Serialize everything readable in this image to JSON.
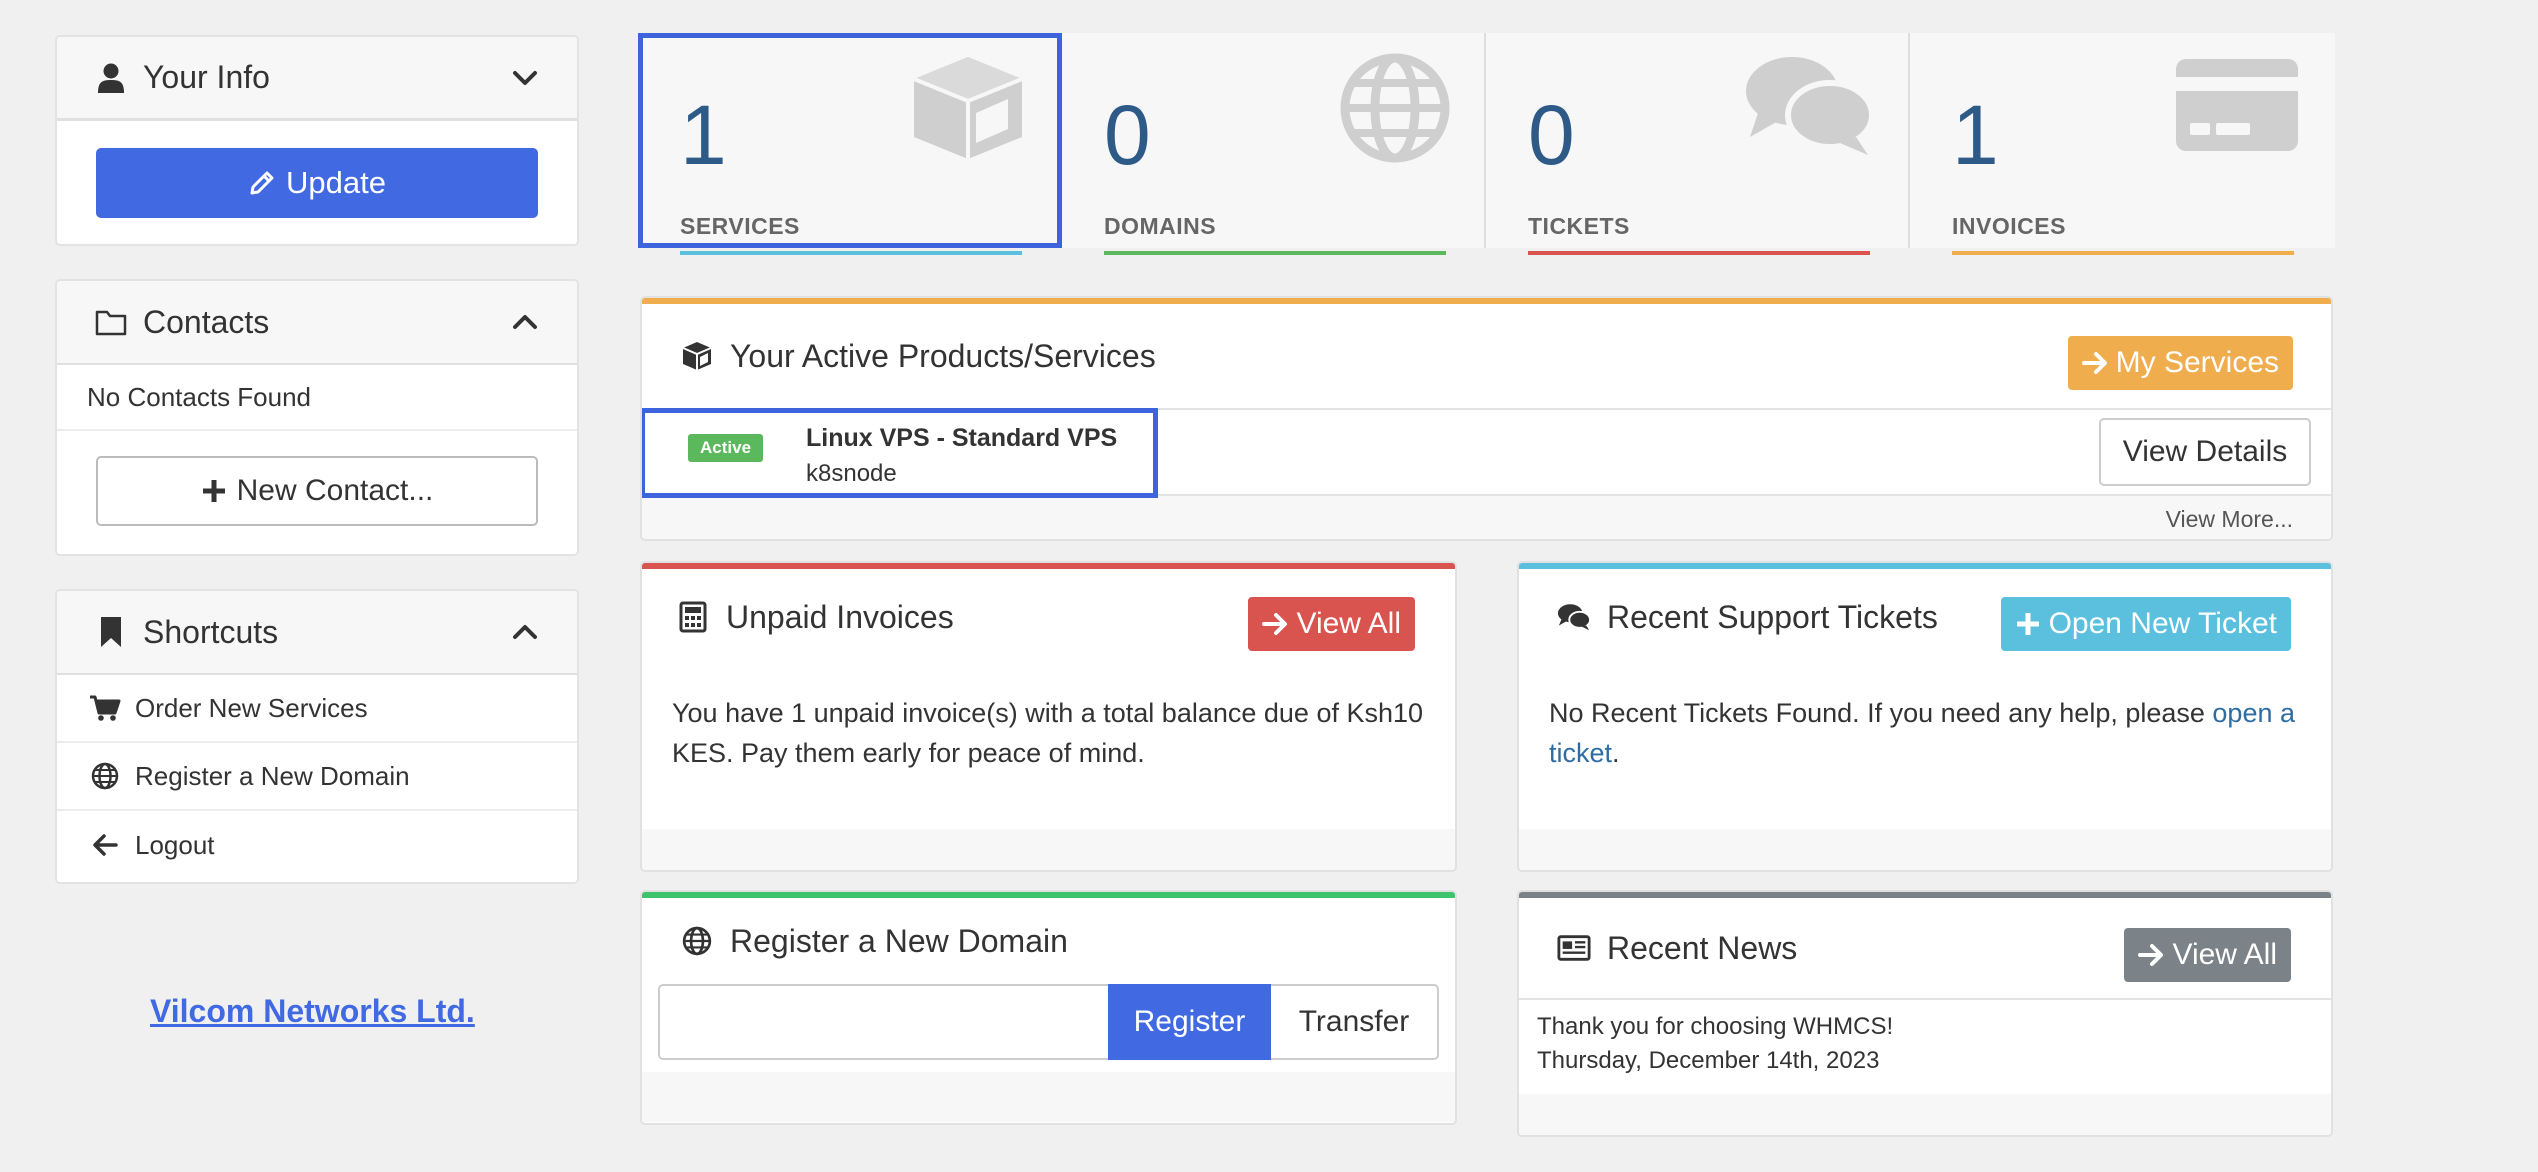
{
  "colors": {
    "primary": "#4169e1",
    "services": "#5bc0de",
    "domains": "#5cb85c",
    "tickets": "#d9534f",
    "invoices": "#f0ad4e",
    "stat_number": "#2e5a87",
    "news": "#7b8388"
  },
  "sidebar": {
    "your_info": {
      "title": "Your Info",
      "update_label": "Update"
    },
    "contacts": {
      "title": "Contacts",
      "empty_text": "No Contacts Found",
      "new_contact_label": "New Contact..."
    },
    "shortcuts": {
      "title": "Shortcuts",
      "items": [
        {
          "label": "Order New Services",
          "icon": "cart-icon"
        },
        {
          "label": "Register a New Domain",
          "icon": "globe-icon"
        },
        {
          "label": "Logout",
          "icon": "arrow-left-icon"
        }
      ]
    },
    "brand_link": "Vilcom Networks Ltd."
  },
  "stats": [
    {
      "value": "1",
      "label": "SERVICES",
      "icon": "cube-icon"
    },
    {
      "value": "0",
      "label": "DOMAINS",
      "icon": "globe-icon"
    },
    {
      "value": "0",
      "label": "TICKETS",
      "icon": "comments-icon"
    },
    {
      "value": "1",
      "label": "INVOICES",
      "icon": "credit-card-icon"
    }
  ],
  "products": {
    "title": "Your Active Products/Services",
    "my_services_label": "My Services",
    "item": {
      "status": "Active",
      "name": "Linux VPS - Standard VPS",
      "hostname": "k8snode",
      "view_details_label": "View Details"
    },
    "view_more_label": "View More..."
  },
  "invoices": {
    "title": "Unpaid Invoices",
    "view_all_label": "View All",
    "message": "You have 1 unpaid invoice(s) with a total balance due of Ksh10 KES. Pay them early for peace of mind."
  },
  "tickets": {
    "title": "Recent Support Tickets",
    "open_ticket_label": "Open New Ticket",
    "message_prefix": "No Recent Tickets Found. If you need any help, please ",
    "message_link": "open a ticket",
    "message_suffix": "."
  },
  "domain": {
    "title": "Register a New Domain",
    "input_value": "",
    "register_label": "Register",
    "transfer_label": "Transfer"
  },
  "news": {
    "title": "Recent News",
    "view_all_label": "View All",
    "headline": "Thank you for choosing WHMCS!",
    "date": "Thursday, December 14th, 2023"
  }
}
